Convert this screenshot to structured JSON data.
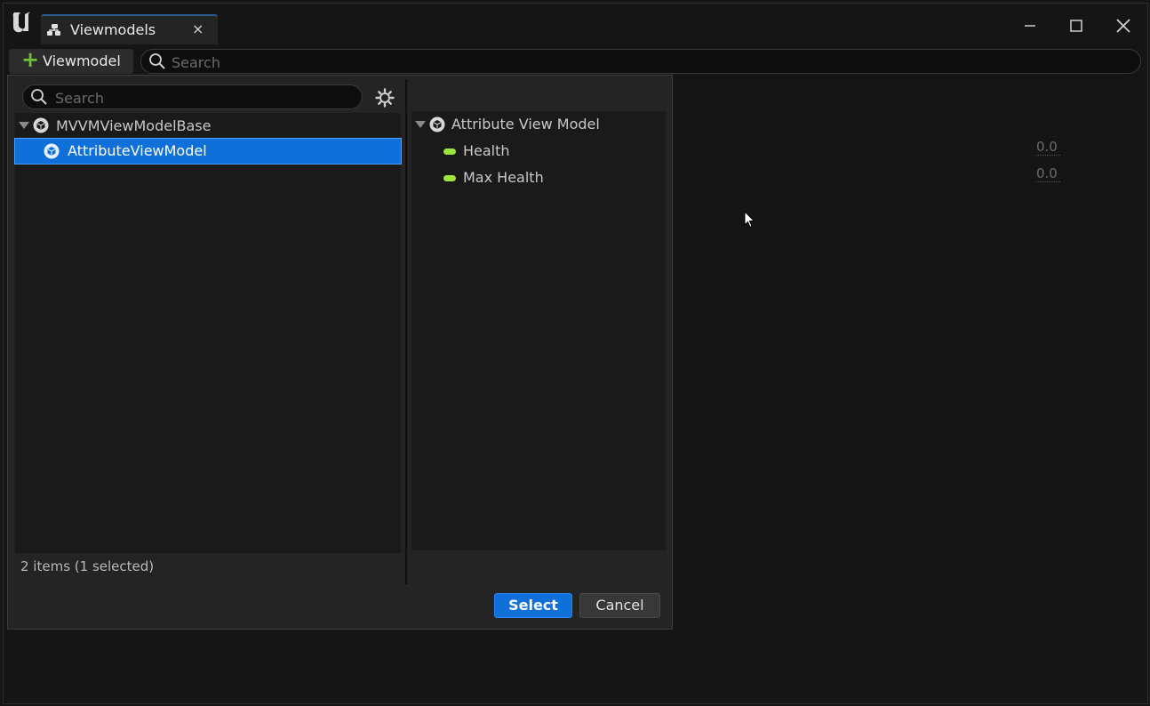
{
  "window": {
    "tab_title": "Viewmodels",
    "tab_close": "×"
  },
  "toolbar": {
    "add_button_label": "Viewmodel",
    "search_placeholder": "Search"
  },
  "background_values": [
    "0.0",
    "0.0"
  ],
  "dialog": {
    "search_placeholder": "Search",
    "tree": [
      {
        "label": "MVVMViewModelBase",
        "expanded": true,
        "selected": false
      },
      {
        "label": "AttributeViewModel",
        "selected": true
      }
    ],
    "status": "2 items (1 selected)",
    "details": {
      "header": "Attribute View Model",
      "properties": [
        "Health",
        "Max Health"
      ]
    },
    "select_label": "Select",
    "cancel_label": "Cancel"
  },
  "colors": {
    "accent": "#0e70d8",
    "property_pill": "#9ae63a",
    "add_plus": "#6fbf3a"
  }
}
